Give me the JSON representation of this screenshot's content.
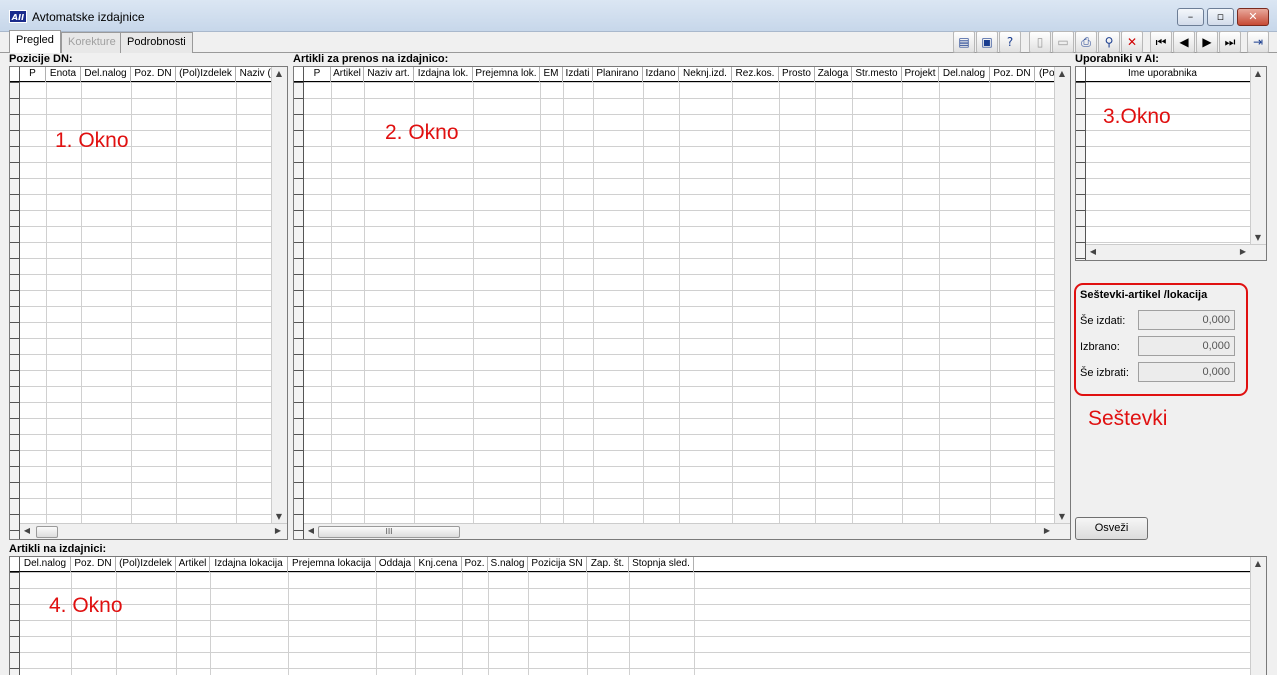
{
  "window": {
    "title": "Avtomatske izdajnice",
    "app_icon_text": "AII"
  },
  "tabs": [
    {
      "label": "Pregled"
    },
    {
      "label": "Korekture"
    },
    {
      "label": "Podrobnosti"
    }
  ],
  "toolbar": {
    "icons": [
      "report-icon",
      "export-icon",
      "help-icon",
      "new-document-icon",
      "open-folder-icon",
      "print-icon",
      "search-icon",
      "delete-icon",
      "first-record-icon",
      "previous-record-icon",
      "next-record-icon",
      "last-record-icon",
      "exit-icon"
    ]
  },
  "panel1": {
    "label": "Pozicije DN:",
    "columns": [
      "P",
      "Enota",
      "Del.nalog",
      "Poz. DN",
      "(Pol)Izdelek",
      "Naziv (p"
    ],
    "annotation": "1. Okno"
  },
  "panel2": {
    "label": "Artikli za prenos na izdajnico:",
    "columns": [
      "P",
      "Artikel",
      "Naziv art.",
      "Izdajna lok.",
      "Prejemna lok.",
      "EM",
      "Izdati",
      "Planirano",
      "Izdano",
      "Neknj.izd.",
      "Rez.kos.",
      "Prosto",
      "Zaloga",
      "Str.mesto",
      "Projekt",
      "Del.nalog",
      "Poz. DN",
      "(Pol)"
    ],
    "annotation": "2. Okno",
    "scroll_thumb": "III"
  },
  "panel3": {
    "label": "Uporabniki v AI:",
    "columns": [
      "Ime uporabnika"
    ],
    "annotation": "3.Okno"
  },
  "sums": {
    "title": "Seštevki-artikel /lokacija",
    "rows": [
      {
        "label": "Še izdati:",
        "value": "0,000"
      },
      {
        "label": "Izbrano:",
        "value": "0,000"
      },
      {
        "label": "Še izbrati:",
        "value": "0,000"
      }
    ],
    "annotation": "Seštevki",
    "accent": "#e01010"
  },
  "refresh_button": "Osveži",
  "panel4": {
    "label": "Artikli na izdajnici:",
    "columns": [
      "Del.nalog",
      "Poz. DN",
      "(Pol)Izdelek",
      "Artikel",
      "Izdajna lokacija",
      "Prejemna lokacija",
      "Oddaja",
      "Knj.cena",
      "Poz.",
      "S.nalog",
      "Pozicija SN",
      "Zap. št.",
      "Stopnja sled."
    ],
    "annotation": "4. Okno"
  }
}
